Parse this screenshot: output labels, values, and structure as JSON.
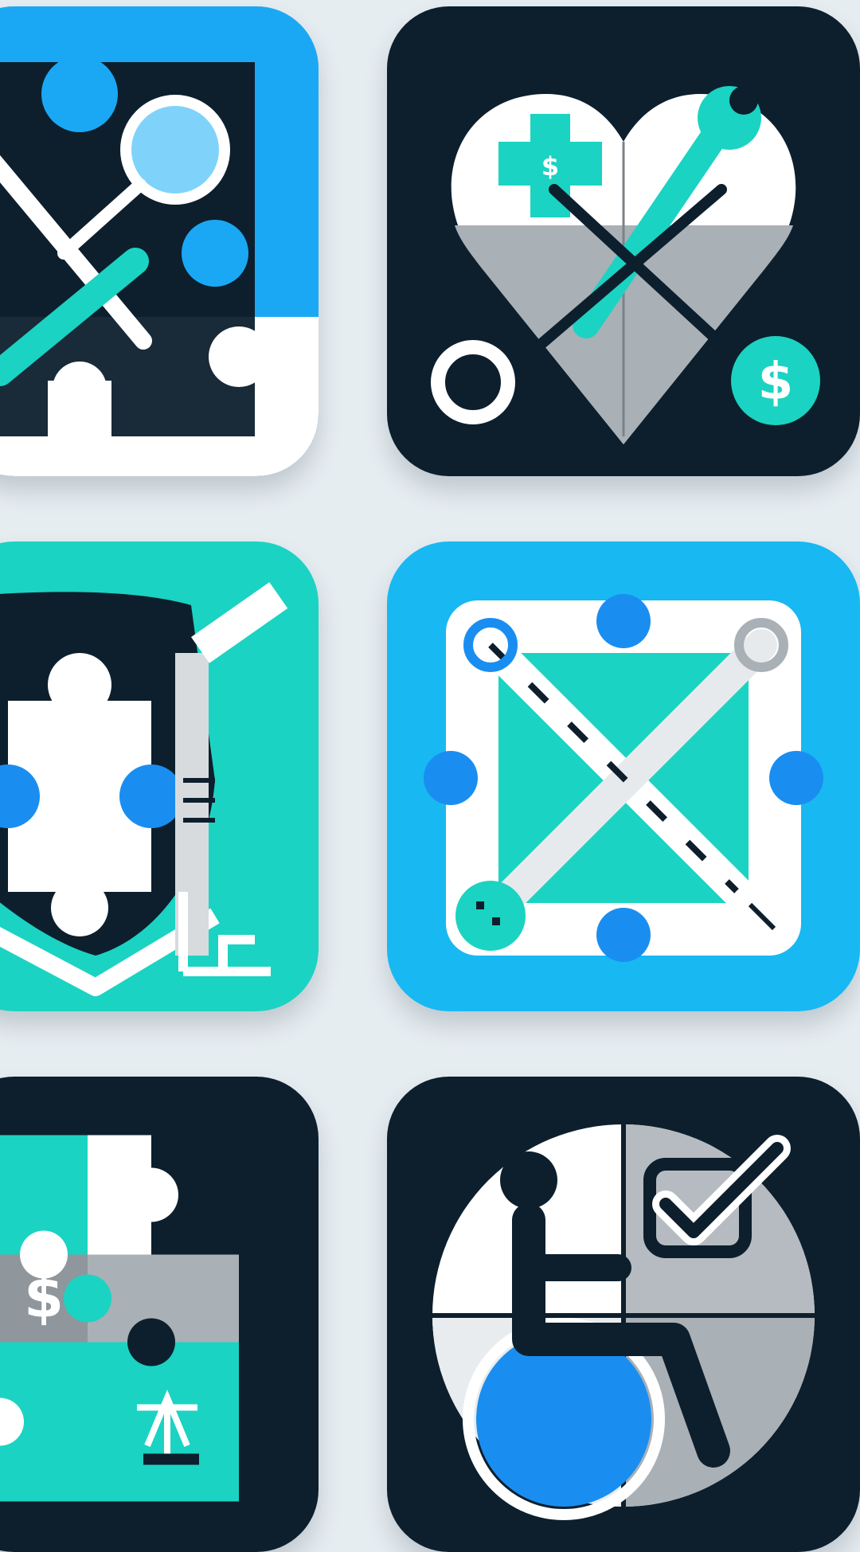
{
  "icons": [
    {
      "name": "puzzle-tools-magnifier",
      "icons": [
        "puzzle-icon",
        "magnifier-icon",
        "wrench-icon"
      ]
    },
    {
      "name": "heart-puzzle-finance",
      "symbols": [
        "$",
        "$"
      ],
      "icons": [
        "heart-icon",
        "wrench-icon",
        "dollar-icon"
      ]
    },
    {
      "name": "shield-puzzle-ruler",
      "icons": [
        "shield-icon",
        "puzzle-icon",
        "ruler-icon"
      ]
    },
    {
      "name": "crossed-tools-puzzle",
      "icons": [
        "wrench-icon",
        "puzzle-icon"
      ]
    },
    {
      "name": "puzzle-grid-finance",
      "symbols": [
        "$"
      ],
      "icons": [
        "puzzle-icon",
        "dollar-icon",
        "scale-icon"
      ]
    },
    {
      "name": "accessibility-checkmark",
      "icons": [
        "wheelchair-icon",
        "checkmark-icon"
      ]
    }
  ],
  "colors": {
    "background": "#e6edf1",
    "navy": "#0d1f2d",
    "teal": "#1bd3c2",
    "sky": "#18b8f2",
    "blue": "#1a8ef0",
    "gray": "#a9b0b6",
    "white": "#ffffff"
  }
}
